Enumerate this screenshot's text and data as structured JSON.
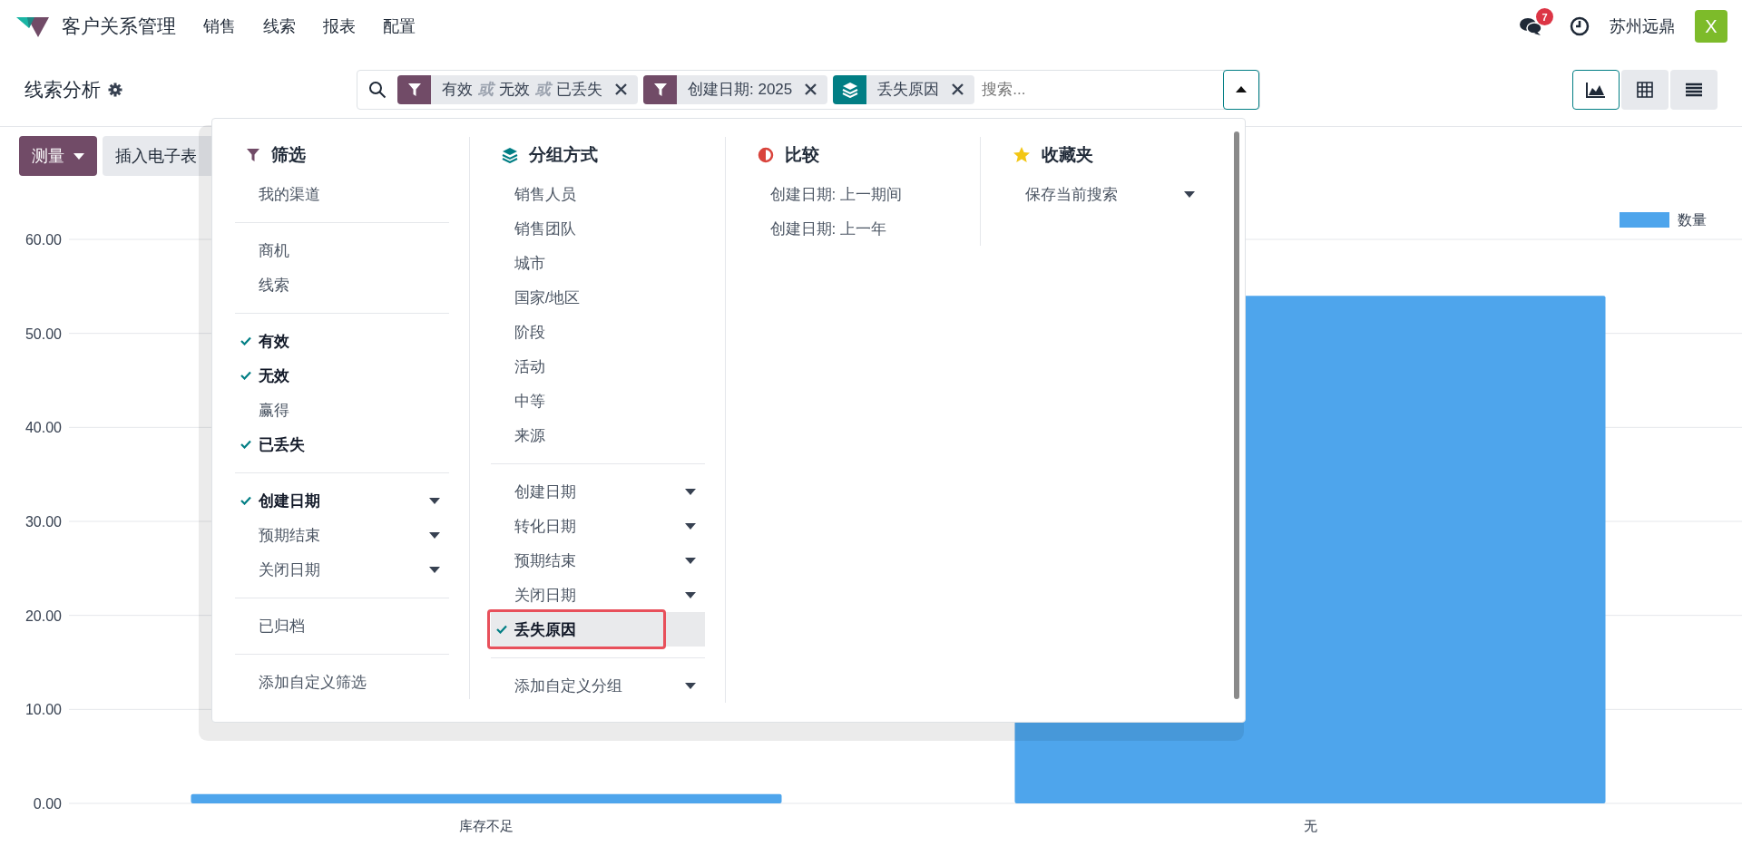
{
  "app": {
    "title": "客户关系管理",
    "menu": [
      "销售",
      "线索",
      "报表",
      "配置"
    ]
  },
  "systray": {
    "message_count": "7",
    "company": "苏州远鼎",
    "avatar_letter": "X"
  },
  "control_panel": {
    "title": "线索分析",
    "facets": [
      {
        "kind": "filter",
        "parts": [
          {
            "kind": "value",
            "text": "有效"
          },
          {
            "kind": "or",
            "text": "或"
          },
          {
            "kind": "value",
            "text": "无效"
          },
          {
            "kind": "or",
            "text": "或"
          },
          {
            "kind": "value",
            "text": "已丢失"
          }
        ]
      },
      {
        "kind": "filter",
        "parts": [
          {
            "kind": "value",
            "text": "创建日期: 2025"
          }
        ]
      },
      {
        "kind": "group",
        "parts": [
          {
            "kind": "value",
            "text": "丢失原因"
          }
        ]
      }
    ],
    "search": {
      "placeholder": "搜索..."
    },
    "views": [
      {
        "kind": "graph",
        "selected": true
      },
      {
        "kind": "pivot",
        "selected": false
      },
      {
        "kind": "list",
        "selected": false
      }
    ]
  },
  "toolbar": {
    "measure": "测量",
    "insert": "插入电子表"
  },
  "search_panel": {
    "sections": [
      {
        "kind": "filter",
        "title": "筛选",
        "groups": [
          [
            {
              "label": "我的渠道",
              "checked": false,
              "kind": "plain"
            }
          ],
          [
            {
              "label": "商机",
              "checked": false,
              "kind": "plain"
            },
            {
              "label": "线索",
              "checked": false,
              "kind": "plain"
            }
          ],
          [
            {
              "label": "有效",
              "checked": true,
              "kind": "plain"
            },
            {
              "label": "无效",
              "checked": true,
              "kind": "plain"
            },
            {
              "label": "赢得",
              "checked": false,
              "kind": "plain"
            },
            {
              "label": "已丢失",
              "checked": true,
              "kind": "plain"
            }
          ],
          [
            {
              "label": "创建日期",
              "checked": true,
              "kind": "dropdown"
            },
            {
              "label": "预期结束",
              "checked": false,
              "kind": "dropdown"
            },
            {
              "label": "关闭日期",
              "checked": false,
              "kind": "dropdown"
            }
          ],
          [
            {
              "label": "已归档",
              "checked": false,
              "kind": "plain"
            }
          ],
          [
            {
              "label": "添加自定义筛选",
              "checked": false,
              "kind": "plain"
            }
          ]
        ]
      },
      {
        "kind": "groupby",
        "title": "分组方式",
        "groups": [
          [
            {
              "label": "销售人员",
              "checked": false,
              "kind": "plain"
            },
            {
              "label": "销售团队",
              "checked": false,
              "kind": "plain"
            },
            {
              "label": "城市",
              "checked": false,
              "kind": "plain"
            },
            {
              "label": "国家/地区",
              "checked": false,
              "kind": "plain"
            },
            {
              "label": "阶段",
              "checked": false,
              "kind": "plain"
            },
            {
              "label": "活动",
              "checked": false,
              "kind": "plain"
            },
            {
              "label": "中等",
              "checked": false,
              "kind": "plain"
            },
            {
              "label": "来源",
              "checked": false,
              "kind": "plain"
            }
          ],
          [
            {
              "label": "创建日期",
              "checked": false,
              "kind": "dropdown"
            },
            {
              "label": "转化日期",
              "checked": false,
              "kind": "dropdown"
            },
            {
              "label": "预期结束",
              "checked": false,
              "kind": "dropdown"
            },
            {
              "label": "关闭日期",
              "checked": false,
              "kind": "dropdown"
            },
            {
              "label": "丢失原因",
              "checked": true,
              "kind": "plain",
              "highlighted": true
            }
          ],
          [
            {
              "label": "添加自定义分组",
              "checked": false,
              "kind": "dropdown"
            }
          ]
        ]
      },
      {
        "kind": "compare",
        "title": "比较",
        "groups": [
          [
            {
              "label": "创建日期: 上一期间",
              "kind": "plain"
            },
            {
              "label": "创建日期: 上一年",
              "kind": "plain"
            }
          ]
        ]
      },
      {
        "kind": "favorites",
        "title": "收藏夹",
        "groups": [
          [
            {
              "label": "保存当前搜索",
              "kind": "dropdown"
            }
          ]
        ]
      }
    ]
  },
  "chart": {
    "chart_data": {
      "type": "bar",
      "grid": true,
      "categories": [
        "库存不足",
        "无"
      ],
      "series": [
        {
          "name": "数量",
          "color": "#4ea5ec",
          "values": [
            1,
            54
          ]
        }
      ],
      "ylim": [
        0,
        60
      ],
      "yticks": [
        {
          "value": 0,
          "label": "0.00"
        },
        {
          "value": 10,
          "label": "10.00"
        },
        {
          "value": 20,
          "label": "20.00"
        },
        {
          "value": 30,
          "label": "30.00"
        },
        {
          "value": 40,
          "label": "40.00"
        },
        {
          "value": 50,
          "label": "50.00"
        },
        {
          "value": 60,
          "label": "60.00"
        }
      ]
    }
  }
}
